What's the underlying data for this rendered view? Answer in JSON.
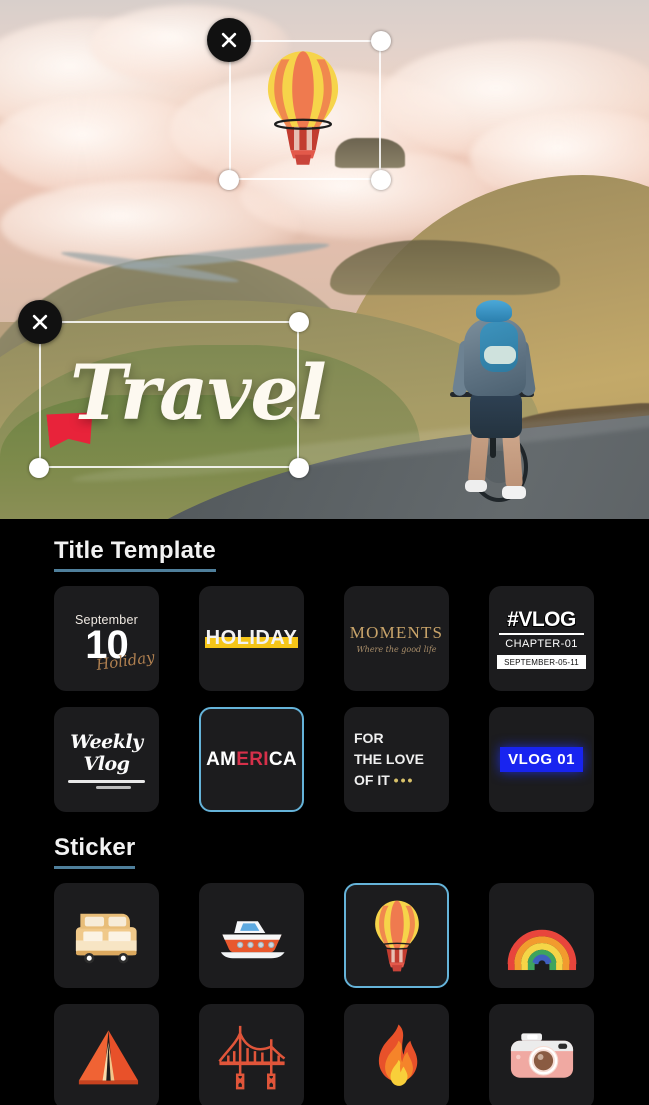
{
  "preview": {
    "scene_description": "Sunset landscape with golden hills, winding road and a cyclist",
    "overlays": [
      {
        "id": "balloon-sticker",
        "name": "hot-air-balloon-sticker",
        "close_label": "×",
        "selected": true
      },
      {
        "id": "travel-title",
        "name": "travel-text-overlay",
        "text": "Travel",
        "close_label": "×",
        "selected": true
      }
    ]
  },
  "sections": [
    {
      "id": "title-template",
      "title": "Title Template",
      "accent": "#4f7f9b",
      "items": [
        {
          "id": "september-10",
          "name": "september-10",
          "month": "September",
          "day": "10",
          "script": "Holiday",
          "selected": false
        },
        {
          "id": "holiday",
          "name": "holiday",
          "word": "HOLIDAY",
          "bar_color": "#f5c518",
          "selected": false
        },
        {
          "id": "moments",
          "name": "moments",
          "word": "MOMENTS",
          "subtitle": "Where the good life",
          "color": "#c9a46a",
          "selected": false
        },
        {
          "id": "vlog-chapter",
          "name": "vlog-chapter",
          "title": "#VLOG",
          "chapter": "CHAPTER-01",
          "date": "SEPTEMBER-05-11",
          "selected": false
        },
        {
          "id": "weekly-vlog",
          "name": "weekly-vlog",
          "script": "Weekly Vlog",
          "selected": false
        },
        {
          "id": "america",
          "name": "america",
          "part1": "AM",
          "part2": "ERI",
          "part3": "CA",
          "accent": "#d6304a",
          "selected": true
        },
        {
          "id": "for-the-love-of-it",
          "name": "for-the-love-of-it",
          "line1": "FOR",
          "line2": "THE LOVE",
          "line3": "OF IT",
          "dots": "•••",
          "selected": false
        },
        {
          "id": "vlog-01",
          "name": "vlog-01",
          "word": "VLOG 01",
          "chip_color": "#1824f0",
          "selected": false
        }
      ]
    },
    {
      "id": "sticker",
      "title": "Sticker",
      "accent": "#4f7f9b",
      "items": [
        {
          "id": "rv",
          "name": "rv-camper-sticker",
          "label": "RV Camper",
          "selected": false
        },
        {
          "id": "boat",
          "name": "motorboat-sticker",
          "label": "Motorboat",
          "selected": false
        },
        {
          "id": "balloon",
          "name": "hot-air-balloon-sticker",
          "label": "Hot Air Balloon",
          "selected": true
        },
        {
          "id": "rainbow",
          "name": "rainbow-sticker",
          "label": "Rainbow",
          "selected": false
        },
        {
          "id": "tent",
          "name": "tent-sticker",
          "label": "Tent",
          "selected": false
        },
        {
          "id": "bridge",
          "name": "bridge-sticker",
          "label": "Golden Gate Bridge",
          "selected": false
        },
        {
          "id": "fire",
          "name": "fire-sticker",
          "label": "Fire",
          "selected": false
        },
        {
          "id": "camera",
          "name": "camera-sticker",
          "label": "Camera",
          "selected": false
        }
      ]
    }
  ],
  "colors": {
    "background": "#000000",
    "tile": "#1c1c1e",
    "selection": "#65b3d9",
    "underline": "#4f7f9b",
    "text": "#f2f2f2"
  }
}
